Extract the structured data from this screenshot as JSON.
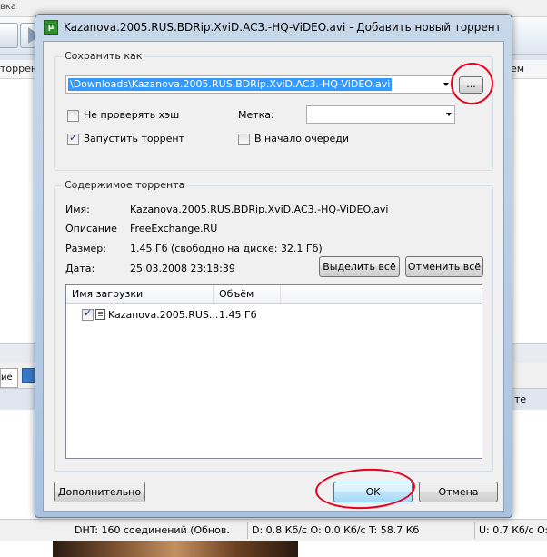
{
  "background": {
    "menu_fragment": "вка",
    "col_header_left": "торрент",
    "col_header_right": "ем",
    "lower_tab_fragment": "ие",
    "lower_col_right": "те",
    "status": {
      "dht": "DHT: 160 соединений  (Обнов.",
      "down": "D: 0.8 Кб/с O: 0.0 Кб/с T: 58.7 Кб",
      "up": "U: 0.7 Кб/с O:"
    }
  },
  "dialog": {
    "title": "Kazanova.2005.RUS.BDRip.XviD.AC3.-HQ-ViDEO.avi - Добавить новый торрент",
    "save_as": {
      "group_label": "Сохранить как",
      "path_value": "\\Downloads\\Kazanova.2005.RUS.BDRip.XviD.AC3.-HQ-ViDEO.avi",
      "browse_label": "...",
      "skip_hash_label": "Не проверять хэш",
      "skip_hash_checked": false,
      "start_torrent_label": "Запустить торрент",
      "start_torrent_checked": true,
      "label_label": "Метка:",
      "label_value": "",
      "queue_top_label": "В начало очереди",
      "queue_top_checked": false
    },
    "contents": {
      "group_label": "Содержимое торрента",
      "name_label": "Имя:",
      "name_value": "Kazanova.2005.RUS.BDRip.XviD.AC3.-HQ-ViDEO.avi",
      "comment_label": "Описание",
      "comment_value": "FreeExchange.RU",
      "size_label": "Размер:",
      "size_value": "1.45 Гб (свободно на диске: 32.1 Гб)",
      "date_label": "Дата:",
      "date_value": "25.03.2008 23:18:39",
      "select_all_label": "Выделить всё",
      "deselect_all_label": "Отменить всё",
      "columns": [
        "Имя загрузки",
        "Объём"
      ],
      "files": [
        {
          "name": "Kazanova.2005.RUS...",
          "size": "1.45 Гб",
          "checked": true
        }
      ]
    },
    "buttons": {
      "advanced": "Дополнительно",
      "ok": "OK",
      "cancel": "Отмена"
    },
    "annotation_color": "#e8001c"
  }
}
